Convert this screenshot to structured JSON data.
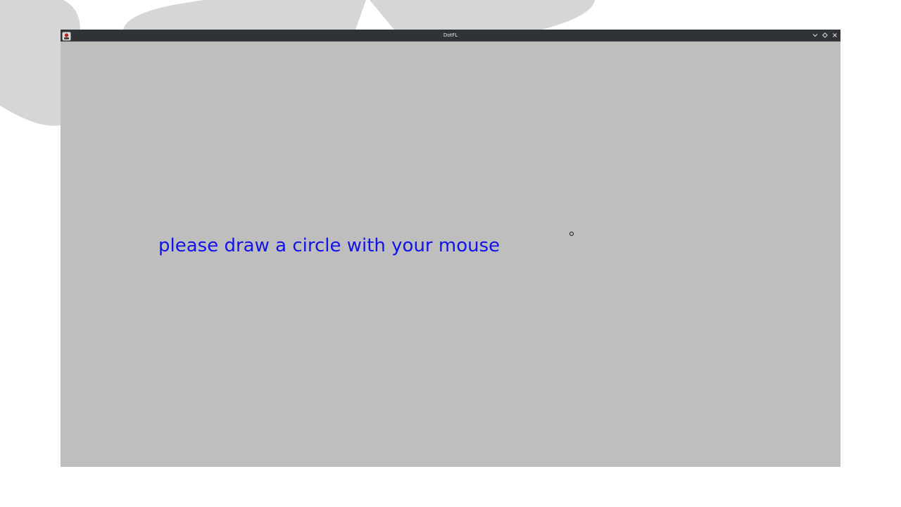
{
  "window": {
    "title": "DotFL",
    "icon": "app-icon",
    "controls": {
      "minimize_icon": "chevron-down-icon",
      "maximize_icon": "diamond-icon",
      "close_icon": "close-icon"
    }
  },
  "canvas": {
    "prompt": "please draw a circle with your mouse",
    "prompt_color": "#1212ee",
    "background_color": "#bebebe"
  },
  "colors": {
    "titlebar": "#2f3236",
    "wallpaper_shapes": "#d6d6d6",
    "desktop": "#ffffff"
  }
}
